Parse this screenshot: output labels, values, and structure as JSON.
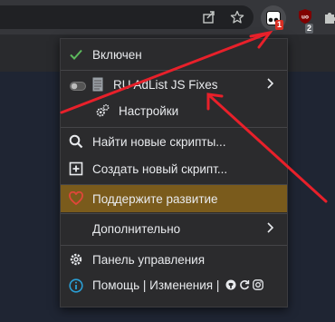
{
  "menu": {
    "enabled_label": "Включен",
    "script_name": "RU AdList JS Fixes",
    "settings_label": "Настройки",
    "find_scripts_label": "Найти новые скрипты...",
    "create_script_label": "Создать новый скрипт...",
    "support_label": "Поддержите развитие",
    "advanced_label": "Дополнительно",
    "dashboard_label": "Панель управления",
    "help_label": "Помощь | Изменения |"
  },
  "toolbar": {
    "tampermonkey_badge": "1",
    "ublock_badge": "2",
    "ublock_label": "uo"
  },
  "colors": {
    "accent_green": "#5cb85c",
    "support_bg": "#7a5b1c",
    "heart_red": "#e0463a",
    "annotation_red": "#e8202a",
    "info_blue": "#2a9fd6"
  },
  "icons": {
    "share": "share-icon",
    "star": "star-icon",
    "tampermonkey": "tampermonkey-icon",
    "ublock": "ublock-icon",
    "puzzle": "puzzle-icon",
    "check": "check-icon",
    "toggle": "toggle-icon",
    "script_file": "script-file-icon",
    "gears": "gears-icon",
    "search": "search-icon",
    "plus_box": "plus-square-icon",
    "heart": "heart-icon",
    "gear": "gear-icon",
    "info": "info-icon",
    "github": "github-icon",
    "refresh": "refresh-icon",
    "instagram": "instagram-icon",
    "chevron": "chevron-right-icon"
  }
}
